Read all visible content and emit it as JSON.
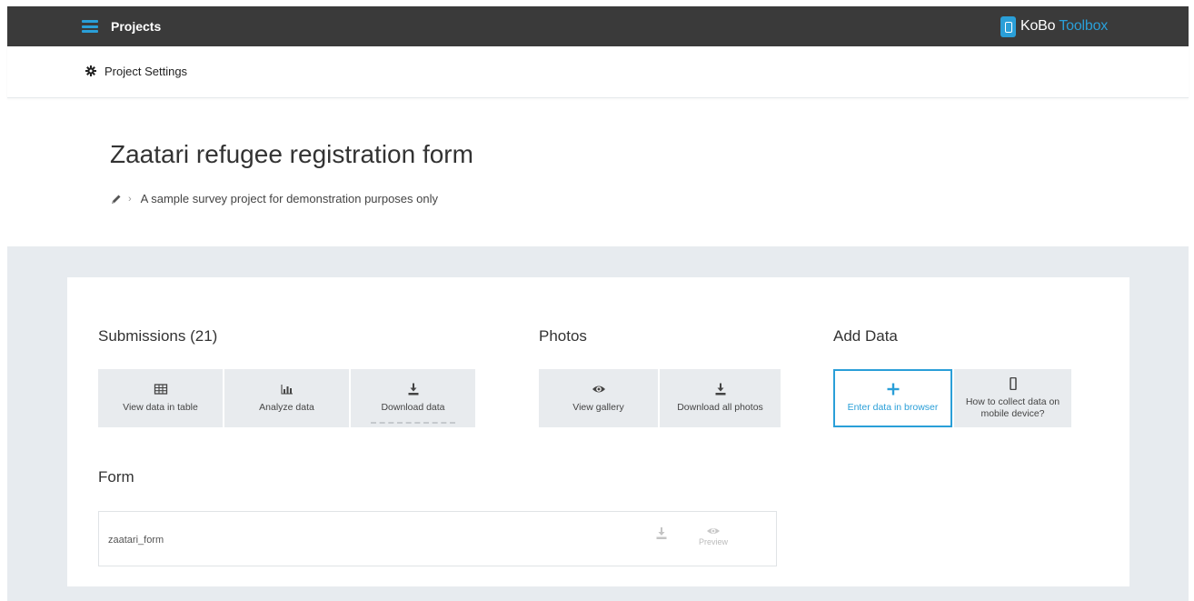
{
  "header": {
    "menu_icon": "hamburger-menu-icon",
    "title": "Projects",
    "brand_left": "KoBo",
    "brand_right": "Toolbox"
  },
  "settings": {
    "icon": "gear-icon",
    "label": "Project Settings"
  },
  "project": {
    "title": "Zaatari refugee registration form",
    "description": "A sample survey project for demonstration purposes only"
  },
  "submissions": {
    "heading": "Submissions (21)",
    "buttons": [
      {
        "label": "View data in table",
        "icon": "table-icon"
      },
      {
        "label": "Analyze data",
        "icon": "bar-chart-icon"
      },
      {
        "label": "Download data",
        "icon": "download-icon"
      }
    ]
  },
  "photos": {
    "heading": "Photos",
    "buttons": [
      {
        "label": "View gallery",
        "icon": "eye-icon"
      },
      {
        "label": "Download all photos",
        "icon": "download-icon"
      }
    ]
  },
  "add_data": {
    "heading": "Add Data",
    "buttons": [
      {
        "label": "Enter data in browser",
        "icon": "plus-icon"
      },
      {
        "label": "How to collect data on mobile device?",
        "icon": "mobile-icon"
      }
    ]
  },
  "form": {
    "heading": "Form",
    "name": "zaatari_form",
    "preview_label": "Preview"
  },
  "colors": {
    "accent": "#2a9fd8",
    "topbar": "#3a3a3a",
    "background_gray": "#e7ebef",
    "tile_gray": "#e8ebee"
  }
}
